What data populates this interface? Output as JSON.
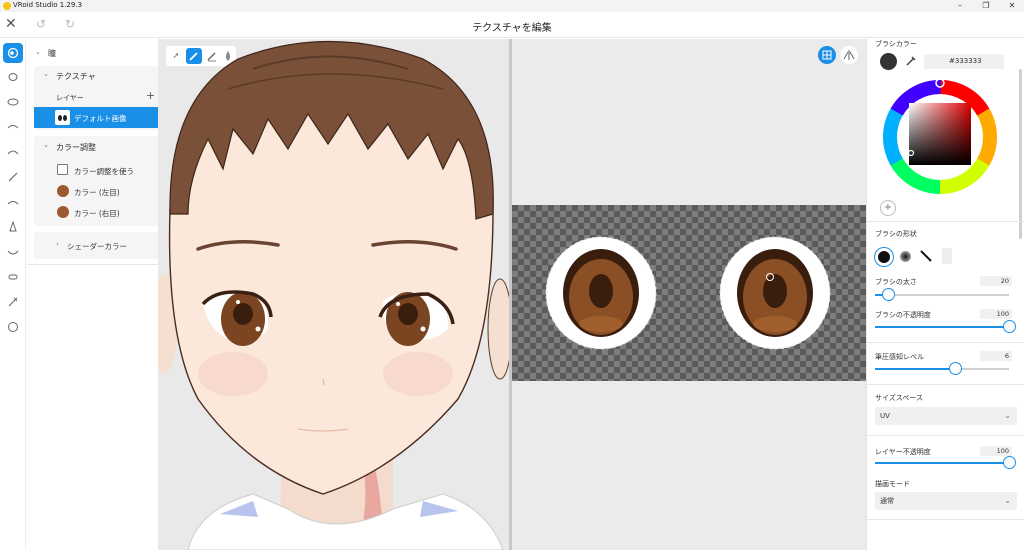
{
  "window": {
    "title": "VRoid Studio 1.29.3"
  },
  "header": {
    "title": "テクスチャを編集"
  },
  "left_panel": {
    "section": "瞳",
    "texture": {
      "title": "テクスチャ",
      "layer_label": "レイヤー",
      "layer_item": "デフォルト画像"
    },
    "color_adjust": {
      "title": "カラー調整",
      "use_label": "カラー調整を使う",
      "left_eye": "カラー (左目)",
      "right_eye": "カラー (右目)",
      "swatch_color": "#9b5a2e"
    },
    "shader": "シェーダーカラー"
  },
  "right_panel": {
    "brush_color": {
      "title": "ブラシカラー",
      "hex": "#333333"
    },
    "brush_shape": {
      "title": "ブラシの形状"
    },
    "brush_size": {
      "label": "ブラシの太さ",
      "value": "20",
      "fraction": 0.1
    },
    "brush_opacity": {
      "label": "ブラシの不透明度",
      "value": "100",
      "fraction": 1.0
    },
    "pressure": {
      "label": "筆圧感知レベル",
      "value": "6",
      "fraction": 0.6
    },
    "size_space": {
      "title": "サイズスペース",
      "value": "UV"
    },
    "layer_opacity": {
      "label": "レイヤー不透明度",
      "value": "100",
      "fraction": 1.0
    },
    "draw_mode": {
      "title": "描画モード",
      "value": "通常"
    }
  },
  "colors": {
    "accent": "#1a8fe8",
    "hair": "#7a5038",
    "iris": "#7a4520"
  }
}
